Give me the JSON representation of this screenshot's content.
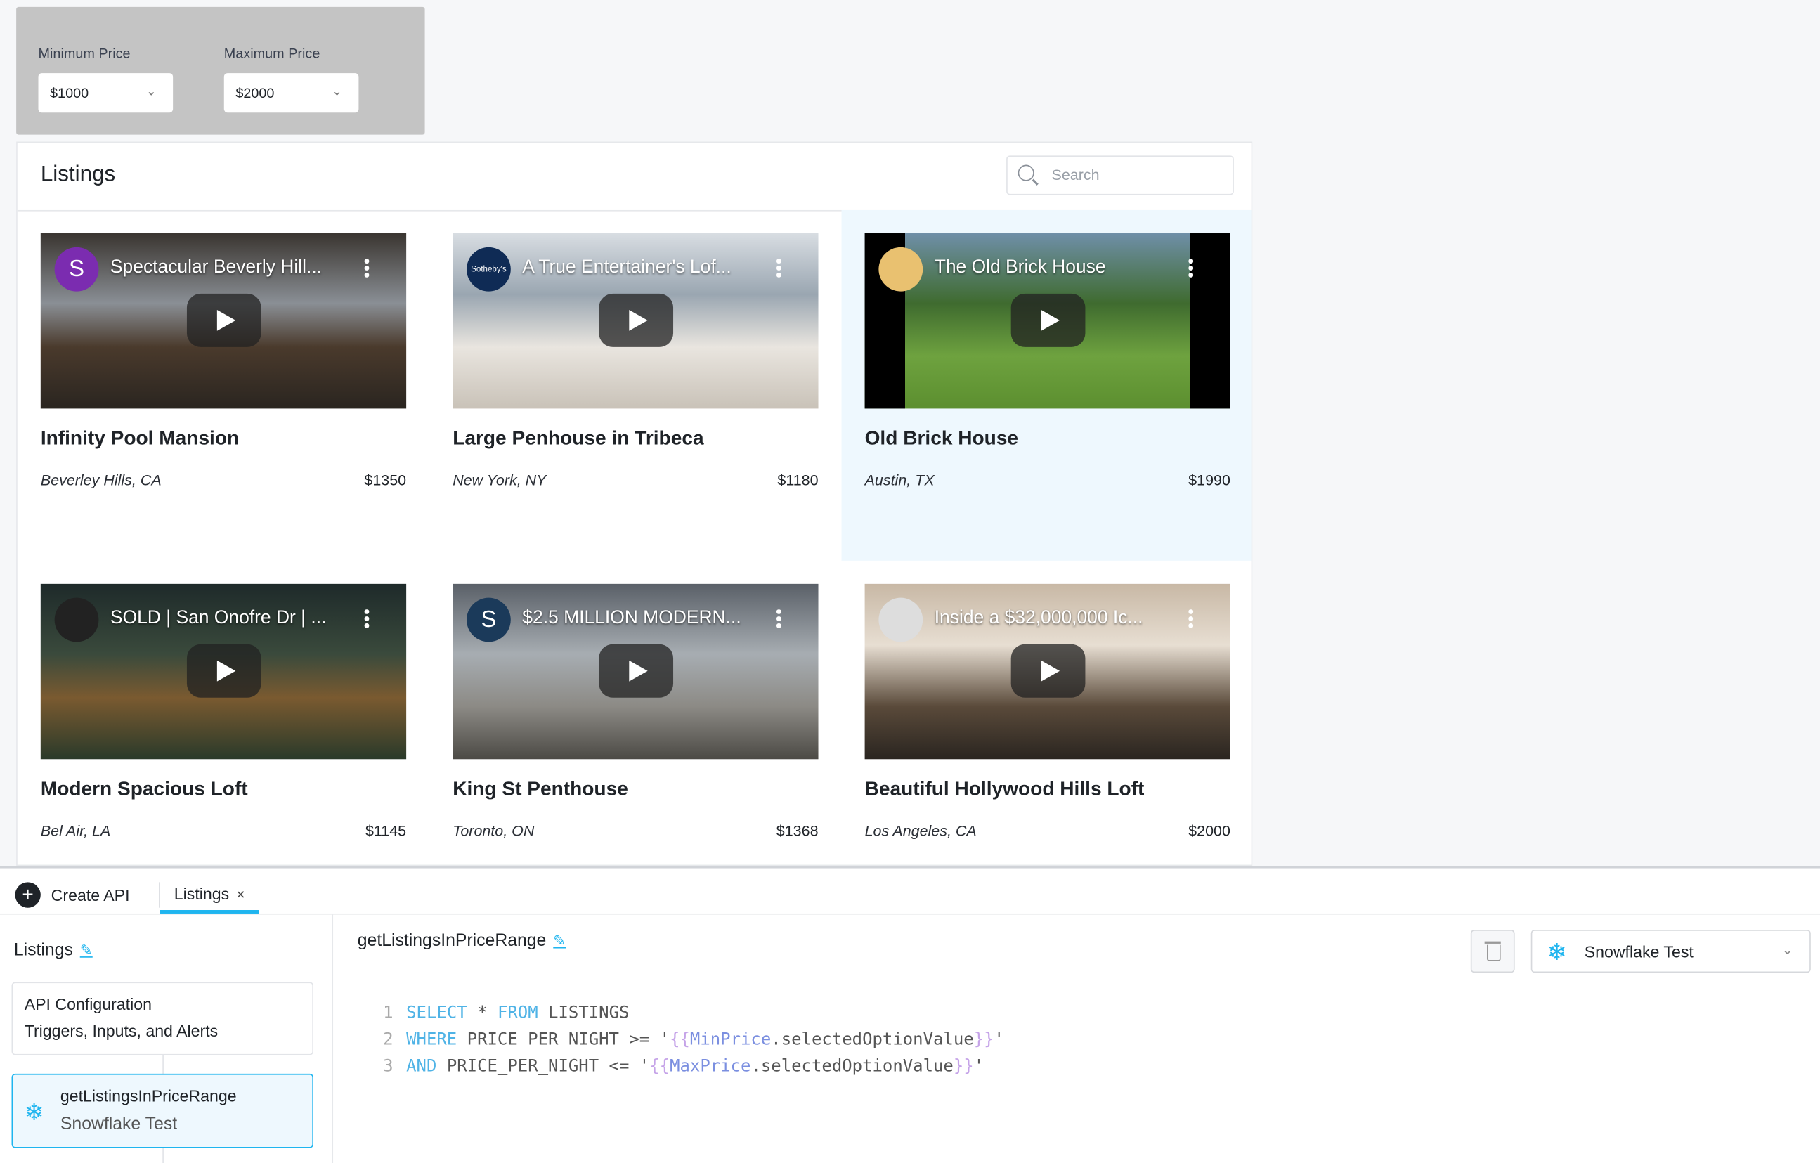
{
  "filters": {
    "min": {
      "label": "Minimum Price",
      "value": "$1000"
    },
    "max": {
      "label": "Maximum Price",
      "value": "$2000"
    }
  },
  "listings": {
    "title": "Listings",
    "search_placeholder": "Search",
    "selected_index": 2,
    "items": [
      {
        "video_title": "Spectacular Beverly Hill...",
        "avatar": "S",
        "avatar_color": "#7b2cb0",
        "title": "Infinity Pool Mansion",
        "location": "Beverley Hills, CA",
        "price": "$1350"
      },
      {
        "video_title": "A True Entertainer's Lof...",
        "avatar": "Sotheby's",
        "avatar_color": "#0f2b55",
        "title": "Large Penhouse in Tribeca",
        "location": "New York, NY",
        "price": "$1180"
      },
      {
        "video_title": "The Old Brick House",
        "avatar": "",
        "avatar_color": "#e9c170",
        "title": "Old Brick House",
        "location": "Austin, TX",
        "price": "$1990"
      },
      {
        "video_title": "SOLD | San Onofre Dr | ...",
        "avatar": "",
        "avatar_color": "#222",
        "title": "Modern Spacious Loft",
        "location": "Bel Air, LA",
        "price": "$1145"
      },
      {
        "video_title": "$2.5 MILLION MODERN...",
        "avatar": "S",
        "avatar_color": "#1b3a5a",
        "title": "King St Penthouse",
        "location": "Toronto, ON",
        "price": "$1368"
      },
      {
        "video_title": "Inside a $32,000,000 Ic...",
        "avatar": "",
        "avatar_color": "#ddd",
        "title": "Beautiful Hollywood Hills Loft",
        "location": "Los Angeles, CA",
        "price": "$2000"
      }
    ]
  },
  "bottom": {
    "create_api": "Create API",
    "tab": "Listings",
    "tab_close": "×",
    "sidebar_title": "Listings",
    "config_title": "API Configuration",
    "config_sub": "Triggers, Inputs, and Alerts",
    "query_name": "getListingsInPriceRange",
    "query_source": "Snowflake Test",
    "datasource": "Snowflake Test",
    "code": [
      {
        "n": "1",
        "kw": "SELECT",
        "rest": " * ",
        "kw2": "FROM",
        "tail": " LISTINGS"
      },
      {
        "n": "2",
        "kw": "WHERE",
        "rest": " PRICE_PER_NIGHT >= '",
        "var": "MinPrice",
        "prop": ".selectedOptionValue"
      },
      {
        "n": "3",
        "kw": "AND",
        "rest": " PRICE_PER_NIGHT <= '",
        "var": "MaxPrice",
        "prop": ".selectedOptionValue"
      }
    ]
  },
  "colors": {
    "accent": "#1fb5ef",
    "selected_bg": "#eef8fe"
  }
}
